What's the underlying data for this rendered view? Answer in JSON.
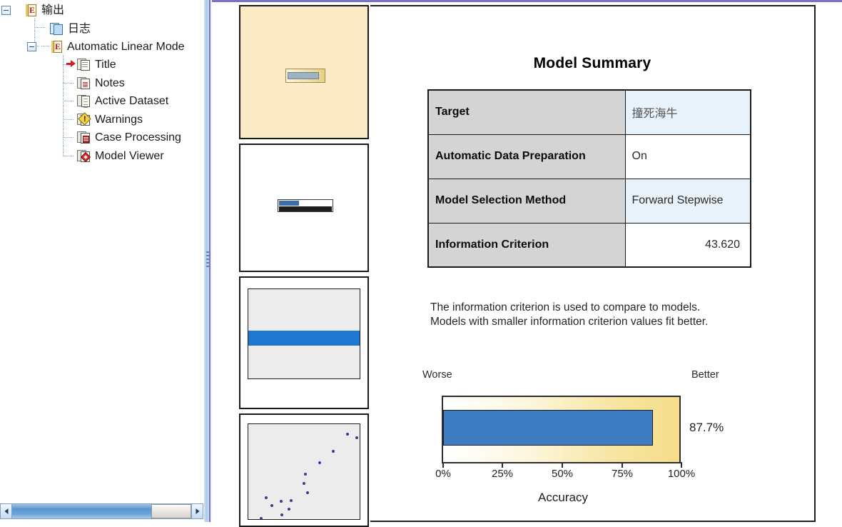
{
  "window": {
    "accent_color": "#7b72c4",
    "bar_blue": "#3d7cc0",
    "label_cell_gray": "#d4d4d4",
    "value_cell_blue": "#e8f2fb"
  },
  "outline_tree": {
    "name": "output-navigator",
    "nodes": [
      {
        "label": "输出",
        "icon": "output-icon",
        "depth": 0,
        "expander": "minus",
        "selected": false
      },
      {
        "label": "日志",
        "icon": "log-icon",
        "depth": 1,
        "expander": "none",
        "selected": false
      },
      {
        "label": "Automatic Linear Mode",
        "icon": "output-icon",
        "depth": 1,
        "expander": "minus",
        "selected": false
      },
      {
        "label": "Title",
        "icon": "title-icon",
        "depth": 2,
        "expander": "none",
        "selected": true
      },
      {
        "label": "Notes",
        "icon": "notes-icon",
        "depth": 2,
        "expander": "none",
        "selected": false
      },
      {
        "label": "Active Dataset",
        "icon": "dataset-icon",
        "depth": 2,
        "expander": "none",
        "selected": false
      },
      {
        "label": "Warnings",
        "icon": "warning-icon",
        "depth": 2,
        "expander": "none",
        "selected": false
      },
      {
        "label": "Case Processing",
        "icon": "case-processing-icon",
        "depth": 2,
        "expander": "none",
        "selected": false
      },
      {
        "label": "Model Viewer",
        "icon": "model-viewer-icon",
        "depth": 2,
        "expander": "none",
        "selected": false
      }
    ]
  },
  "scrollbar": {
    "left_arrow": "scroll-left-arrow",
    "right_arrow": "scroll-right-arrow",
    "orientation": "horizontal"
  },
  "thumbnails": [
    {
      "name": "thumbnail-model-summary",
      "kind": "gauge",
      "selected": true
    },
    {
      "name": "thumbnail-table",
      "kind": "table",
      "selected": false
    },
    {
      "name": "thumbnail-bar-chart",
      "kind": "bars",
      "selected": false
    },
    {
      "name": "thumbnail-scatter-plot",
      "kind": "scatter",
      "selected": false
    }
  ],
  "main": {
    "title": "Model Summary",
    "table": {
      "rows": [
        {
          "label": "Target",
          "value": "撞死海牛",
          "align": "left",
          "shaded": true
        },
        {
          "label": "Automatic Data Preparation",
          "value": "On",
          "align": "left",
          "shaded": false
        },
        {
          "label": "Model Selection Method",
          "value": "Forward Stepwise",
          "align": "left",
          "shaded": true
        },
        {
          "label": "Information Criterion",
          "value": "43.620",
          "align": "right",
          "shaded": false
        }
      ]
    },
    "note": "The information criterion is used to compare to models. Models with smaller information criterion values fit better."
  },
  "chart_data": {
    "type": "bar",
    "title": "",
    "xlabel": "Accuracy",
    "ylabel": "",
    "orientation": "horizontal",
    "categories": [
      "Accuracy"
    ],
    "values": [
      87.7
    ],
    "value_labels": [
      "87.7%"
    ],
    "xlim": [
      0,
      100
    ],
    "tick_labels": [
      "0%",
      "25%",
      "50%",
      "75%",
      "100%"
    ],
    "tick_values": [
      0,
      25,
      50,
      75,
      100
    ],
    "grid": false,
    "legend": "none",
    "annotations": {
      "left_end": "Worse",
      "right_end": "Better"
    },
    "bar_color": "#3d7cc0",
    "background": "gradient white to yellow (worse to better)"
  }
}
